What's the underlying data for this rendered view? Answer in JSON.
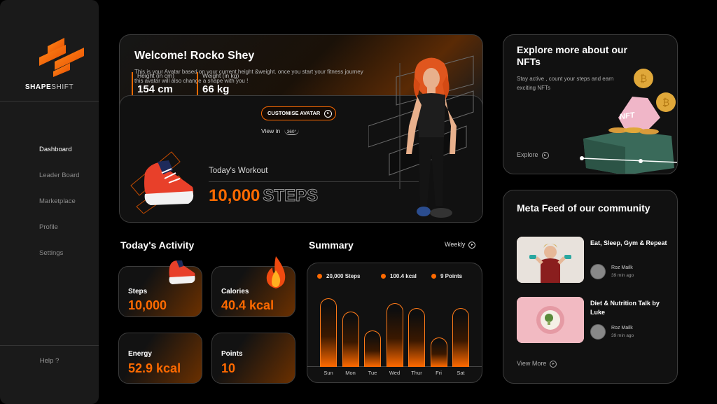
{
  "brand": {
    "name_bold": "SHAPE",
    "name_light": "SHIFT"
  },
  "sidebar": {
    "items": [
      {
        "label": "Dashboard"
      },
      {
        "label": "Leader Board"
      },
      {
        "label": "Marketplace"
      },
      {
        "label": "Profile"
      },
      {
        "label": "Settings"
      }
    ],
    "help_label": "Help ?"
  },
  "welcome": {
    "title": "Welcome! Rocko Shey",
    "description": "This is your Avatar based on your current height &weight. once you start your fitness journey this avatar will also change a shape with you !",
    "height_label": "Height (in cm)",
    "height_value": "154 cm",
    "weight_label": "Weight (in kg)",
    "weight_value": "66 kg",
    "customise_label": "CUSTOMISE AVATAR",
    "view_label": "View in",
    "view_badge": "360°",
    "workout_label": "Today's Workout",
    "workout_value": "10,000",
    "workout_unit": "STEPS"
  },
  "explore": {
    "title": "Explore more about our NFTs",
    "description": "Stay active , count your steps and earn exciting NFTs",
    "link": "Explore",
    "box_label": "NFT"
  },
  "meta": {
    "title": "Meta Feed of our community",
    "posts": [
      {
        "title": "Eat, Sleep, Gym & Repeat",
        "author": "Roz Mailk",
        "time": "39 min ago"
      },
      {
        "title": "Diet & Nutrition Talk by Luke",
        "author": "Roz Mailk",
        "time": "39 min ago"
      }
    ],
    "view_more": "View More"
  },
  "activity": {
    "title": "Today's Activity",
    "cards": [
      {
        "label": "Steps",
        "value": "10,000"
      },
      {
        "label": "Calories",
        "value": "40.4 kcal"
      },
      {
        "label": "Energy",
        "value": "52.9 kcal"
      },
      {
        "label": "Points",
        "value": "10"
      }
    ]
  },
  "summary": {
    "title": "Summary",
    "period": "Weekly",
    "legend": [
      {
        "label": "20,000 Steps"
      },
      {
        "label": "100.4 kcal"
      },
      {
        "label": "9 Points"
      }
    ],
    "days": [
      "Sun",
      "Mon",
      "Tue",
      "Wed",
      "Thur",
      "Fri",
      "Sat"
    ],
    "levels": [
      0.82,
      0.66,
      0.43,
      0.76,
      0.7,
      0.35,
      0.7
    ]
  },
  "colors": {
    "accent": "#ff6a00",
    "background": "#000000",
    "card": "#111111"
  }
}
